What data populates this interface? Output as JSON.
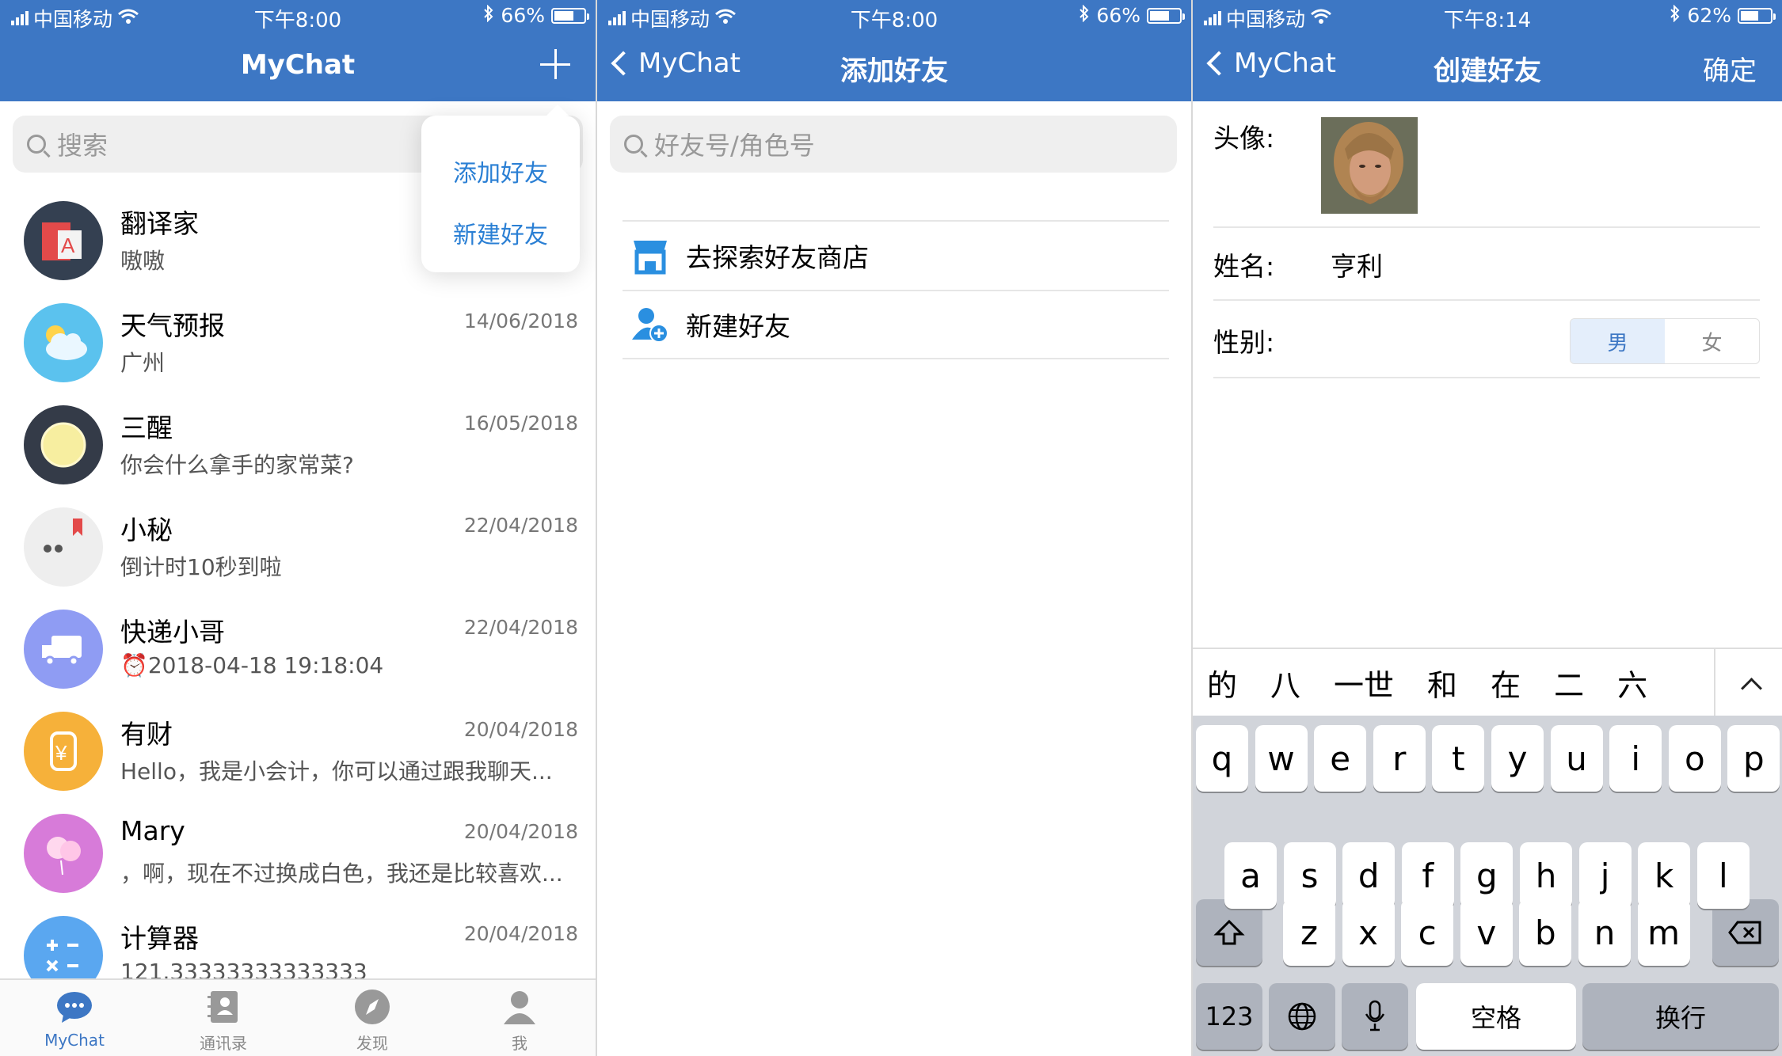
{
  "status_bars": [
    {
      "carrier": "中国移动",
      "time": "下午8:00",
      "battery": "66%",
      "battery_level": 0.66
    },
    {
      "carrier": "中国移动",
      "time": "下午8:00",
      "battery": "66%",
      "battery_level": 0.66
    },
    {
      "carrier": "中国移动",
      "time": "下午8:14",
      "battery": "62%",
      "battery_level": 0.62
    }
  ],
  "screen1": {
    "title": "MyChat",
    "search_placeholder": "搜索",
    "popover": {
      "add_friend": "添加好友",
      "new_friend": "新建好友"
    },
    "chats": [
      {
        "name": "翻译家",
        "date": "",
        "message": "嗷嗷"
      },
      {
        "name": "天气预报",
        "date": "14/06/2018",
        "message": "广州"
      },
      {
        "name": "三醒",
        "date": "16/05/2018",
        "message": "你会什么拿手的家常菜?"
      },
      {
        "name": "小秘",
        "date": "22/04/2018",
        "message": "倒计时10秒到啦"
      },
      {
        "name": "快递小哥",
        "date": "22/04/2018",
        "message": "⏰2018-04-18 19:18:04"
      },
      {
        "name": "有财",
        "date": "20/04/2018",
        "message": "Hello，我是小会计，你可以通过跟我聊天..."
      },
      {
        "name": "Mary",
        "date": "20/04/2018",
        "message": "，啊，现在不过换成白色，我还是比较喜欢..."
      },
      {
        "name": "计算器",
        "date": "20/04/2018",
        "message": "121.33333333333333"
      }
    ],
    "tabs": [
      {
        "label": "MyChat",
        "icon": "chat-bubble-icon"
      },
      {
        "label": "通讯录",
        "icon": "contacts-icon"
      },
      {
        "label": "发现",
        "icon": "compass-icon"
      },
      {
        "label": "我",
        "icon": "person-icon"
      }
    ]
  },
  "screen2": {
    "back_label": "MyChat",
    "title": "添加好友",
    "search_placeholder": "好友号/角色号",
    "items": [
      {
        "label": "去探索好友商店",
        "icon": "store-icon"
      },
      {
        "label": "新建好友",
        "icon": "add-user-icon"
      }
    ]
  },
  "screen3": {
    "back_label": "MyChat",
    "title": "创建好友",
    "confirm_label": "确定",
    "avatar_label": "头像:",
    "name_label": "姓名:",
    "name_value": "亨利",
    "gender_label": "性别:",
    "gender_options": [
      "男",
      "女"
    ],
    "gender_selected": "男",
    "candidates": [
      "的",
      "八",
      "一世",
      "和",
      "在",
      "二",
      "六"
    ],
    "keyboard": {
      "row1": [
        "q",
        "w",
        "e",
        "r",
        "t",
        "y",
        "u",
        "i",
        "o",
        "p"
      ],
      "row2": [
        "a",
        "s",
        "d",
        "f",
        "g",
        "h",
        "j",
        "k",
        "l"
      ],
      "row3": [
        "z",
        "x",
        "c",
        "v",
        "b",
        "n",
        "m"
      ],
      "numbers": "123",
      "space": "空格",
      "return": "换行"
    }
  }
}
